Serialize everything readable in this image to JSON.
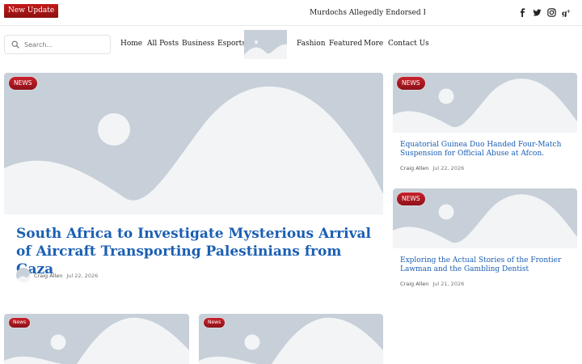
{
  "topbar": {
    "badge_label": "New Update",
    "ticker_text": "Murdochs Allegedly Endorsed Fox News",
    "social": [
      "facebook-icon",
      "twitter-icon",
      "instagram-icon",
      "google-plus-icon"
    ]
  },
  "nav": {
    "search_placeholder": "Search...",
    "links_left": [
      "Home",
      "All Posts",
      "Business",
      "Esports"
    ],
    "links_right": [
      "Fashion",
      "Featured",
      "More",
      "Contact Us"
    ]
  },
  "hero": {
    "category": "NEWS",
    "title": "South Africa to Investigate Mysterious Arrival of Aircraft Transporting Palestinians from Gaza",
    "author": "Craig Allen",
    "date": "Jul 22, 2026"
  },
  "side_posts": [
    {
      "category": "NEWS",
      "title": "Equatorial Guinea Duo Handed Four-Match Suspension for Official Abuse at Afcon.",
      "author": "Craig Allen",
      "date": "Jul 22, 2026"
    },
    {
      "category": "NEWS",
      "title": "Exploring the Actual Stories of the Frontier Lawman and the Gambling Dentist",
      "author": "Craig Allen",
      "date": "Jul 21, 2026"
    }
  ],
  "bottom_posts": [
    {
      "category": "News"
    },
    {
      "category": "News"
    }
  ],
  "colors": {
    "accent": "#1b5fb3",
    "badge": "#b81c24",
    "placeholder": "#c7cfd8"
  }
}
